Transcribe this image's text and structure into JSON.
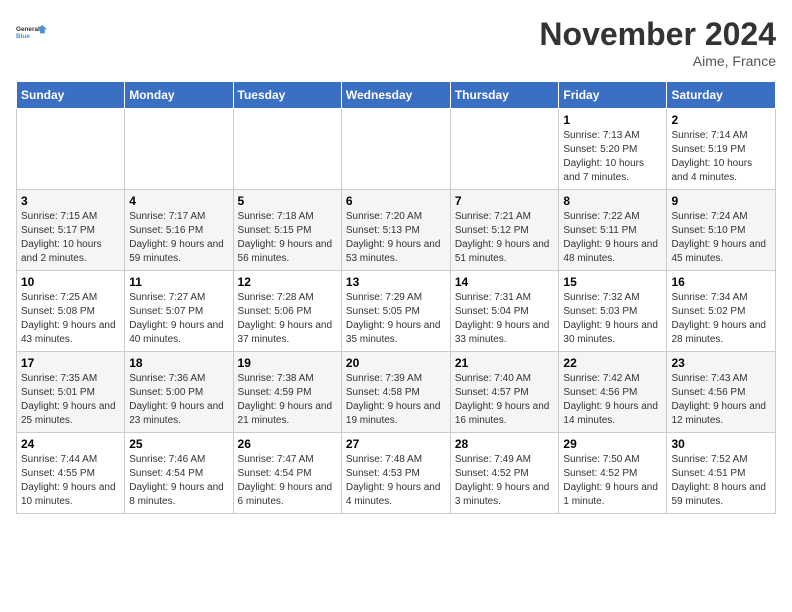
{
  "logo": {
    "text_general": "General",
    "text_blue": "Blue"
  },
  "header": {
    "month": "November 2024",
    "location": "Aime, France"
  },
  "weekdays": [
    "Sunday",
    "Monday",
    "Tuesday",
    "Wednesday",
    "Thursday",
    "Friday",
    "Saturday"
  ],
  "weeks": [
    [
      {
        "day": "",
        "detail": ""
      },
      {
        "day": "",
        "detail": ""
      },
      {
        "day": "",
        "detail": ""
      },
      {
        "day": "",
        "detail": ""
      },
      {
        "day": "",
        "detail": ""
      },
      {
        "day": "1",
        "detail": "Sunrise: 7:13 AM\nSunset: 5:20 PM\nDaylight: 10 hours and 7 minutes."
      },
      {
        "day": "2",
        "detail": "Sunrise: 7:14 AM\nSunset: 5:19 PM\nDaylight: 10 hours and 4 minutes."
      }
    ],
    [
      {
        "day": "3",
        "detail": "Sunrise: 7:15 AM\nSunset: 5:17 PM\nDaylight: 10 hours and 2 minutes."
      },
      {
        "day": "4",
        "detail": "Sunrise: 7:17 AM\nSunset: 5:16 PM\nDaylight: 9 hours and 59 minutes."
      },
      {
        "day": "5",
        "detail": "Sunrise: 7:18 AM\nSunset: 5:15 PM\nDaylight: 9 hours and 56 minutes."
      },
      {
        "day": "6",
        "detail": "Sunrise: 7:20 AM\nSunset: 5:13 PM\nDaylight: 9 hours and 53 minutes."
      },
      {
        "day": "7",
        "detail": "Sunrise: 7:21 AM\nSunset: 5:12 PM\nDaylight: 9 hours and 51 minutes."
      },
      {
        "day": "8",
        "detail": "Sunrise: 7:22 AM\nSunset: 5:11 PM\nDaylight: 9 hours and 48 minutes."
      },
      {
        "day": "9",
        "detail": "Sunrise: 7:24 AM\nSunset: 5:10 PM\nDaylight: 9 hours and 45 minutes."
      }
    ],
    [
      {
        "day": "10",
        "detail": "Sunrise: 7:25 AM\nSunset: 5:08 PM\nDaylight: 9 hours and 43 minutes."
      },
      {
        "day": "11",
        "detail": "Sunrise: 7:27 AM\nSunset: 5:07 PM\nDaylight: 9 hours and 40 minutes."
      },
      {
        "day": "12",
        "detail": "Sunrise: 7:28 AM\nSunset: 5:06 PM\nDaylight: 9 hours and 37 minutes."
      },
      {
        "day": "13",
        "detail": "Sunrise: 7:29 AM\nSunset: 5:05 PM\nDaylight: 9 hours and 35 minutes."
      },
      {
        "day": "14",
        "detail": "Sunrise: 7:31 AM\nSunset: 5:04 PM\nDaylight: 9 hours and 33 minutes."
      },
      {
        "day": "15",
        "detail": "Sunrise: 7:32 AM\nSunset: 5:03 PM\nDaylight: 9 hours and 30 minutes."
      },
      {
        "day": "16",
        "detail": "Sunrise: 7:34 AM\nSunset: 5:02 PM\nDaylight: 9 hours and 28 minutes."
      }
    ],
    [
      {
        "day": "17",
        "detail": "Sunrise: 7:35 AM\nSunset: 5:01 PM\nDaylight: 9 hours and 25 minutes."
      },
      {
        "day": "18",
        "detail": "Sunrise: 7:36 AM\nSunset: 5:00 PM\nDaylight: 9 hours and 23 minutes."
      },
      {
        "day": "19",
        "detail": "Sunrise: 7:38 AM\nSunset: 4:59 PM\nDaylight: 9 hours and 21 minutes."
      },
      {
        "day": "20",
        "detail": "Sunrise: 7:39 AM\nSunset: 4:58 PM\nDaylight: 9 hours and 19 minutes."
      },
      {
        "day": "21",
        "detail": "Sunrise: 7:40 AM\nSunset: 4:57 PM\nDaylight: 9 hours and 16 minutes."
      },
      {
        "day": "22",
        "detail": "Sunrise: 7:42 AM\nSunset: 4:56 PM\nDaylight: 9 hours and 14 minutes."
      },
      {
        "day": "23",
        "detail": "Sunrise: 7:43 AM\nSunset: 4:56 PM\nDaylight: 9 hours and 12 minutes."
      }
    ],
    [
      {
        "day": "24",
        "detail": "Sunrise: 7:44 AM\nSunset: 4:55 PM\nDaylight: 9 hours and 10 minutes."
      },
      {
        "day": "25",
        "detail": "Sunrise: 7:46 AM\nSunset: 4:54 PM\nDaylight: 9 hours and 8 minutes."
      },
      {
        "day": "26",
        "detail": "Sunrise: 7:47 AM\nSunset: 4:54 PM\nDaylight: 9 hours and 6 minutes."
      },
      {
        "day": "27",
        "detail": "Sunrise: 7:48 AM\nSunset: 4:53 PM\nDaylight: 9 hours and 4 minutes."
      },
      {
        "day": "28",
        "detail": "Sunrise: 7:49 AM\nSunset: 4:52 PM\nDaylight: 9 hours and 3 minutes."
      },
      {
        "day": "29",
        "detail": "Sunrise: 7:50 AM\nSunset: 4:52 PM\nDaylight: 9 hours and 1 minute."
      },
      {
        "day": "30",
        "detail": "Sunrise: 7:52 AM\nSunset: 4:51 PM\nDaylight: 8 hours and 59 minutes."
      }
    ]
  ]
}
